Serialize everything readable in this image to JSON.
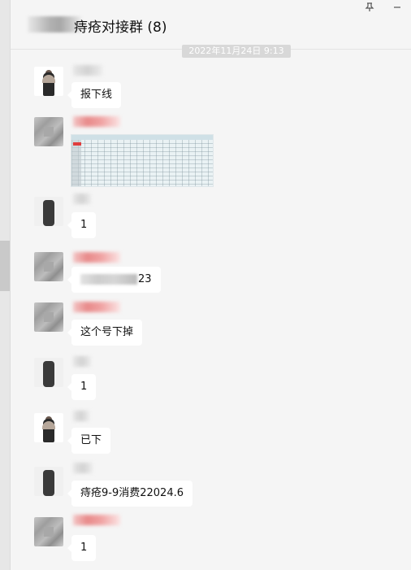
{
  "window": {
    "title": "痔疮对接群 (8)",
    "pin_icon": "pin-icon",
    "minimize_icon": "minimize-icon"
  },
  "timestamp": "2022年11月24日 9:13",
  "messages": [
    {
      "sender_avatar": "person-avatar",
      "type": "text",
      "text": "报下线"
    },
    {
      "sender_avatar": "gray-avatar",
      "type": "image",
      "image_semantic": "spreadsheet-screenshot"
    },
    {
      "sender_avatar": "dark-avatar",
      "type": "text",
      "text": "1"
    },
    {
      "sender_avatar": "gray-avatar",
      "type": "text",
      "text": "23",
      "text_prefix_blurred": true
    },
    {
      "sender_avatar": "gray-avatar",
      "type": "text",
      "text": "这个号下掉"
    },
    {
      "sender_avatar": "dark-avatar",
      "type": "text",
      "text": "1"
    },
    {
      "sender_avatar": "person-avatar",
      "type": "text",
      "text": "已下"
    },
    {
      "sender_avatar": "dark-avatar",
      "type": "text",
      "text": "痔疮9-9消费22024.6"
    },
    {
      "sender_avatar": "gray-avatar",
      "type": "text",
      "text": "1"
    }
  ],
  "colors": {
    "background": "#f5f5f5",
    "bubble": "#ffffff",
    "name_blur_pink": "#e88a8a"
  }
}
